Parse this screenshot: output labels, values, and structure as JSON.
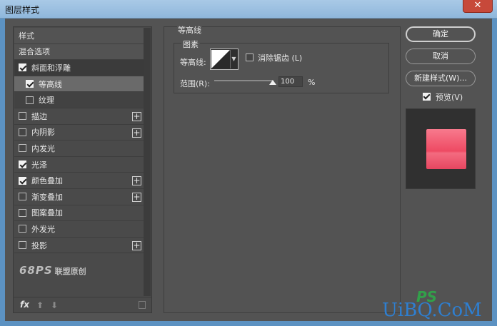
{
  "window": {
    "title": "图层样式",
    "close_glyph": "✕"
  },
  "styles_panel": {
    "items": [
      {
        "label": "样式",
        "type": "header"
      },
      {
        "label": "混合选项",
        "type": "header"
      },
      {
        "label": "斜面和浮雕",
        "checked": true
      },
      {
        "label": "等高线",
        "checked": true,
        "sub": true,
        "selected": true
      },
      {
        "label": "纹理",
        "checked": false,
        "sub": true
      },
      {
        "label": "描边",
        "checked": false,
        "plus": true
      },
      {
        "label": "内阴影",
        "checked": false,
        "plus": true
      },
      {
        "label": "内发光",
        "checked": false
      },
      {
        "label": "光泽",
        "checked": true
      },
      {
        "label": "颜色叠加",
        "checked": true,
        "plus": true
      },
      {
        "label": "渐变叠加",
        "checked": false,
        "plus": true
      },
      {
        "label": "图案叠加",
        "checked": false
      },
      {
        "label": "外发光",
        "checked": false
      },
      {
        "label": "投影",
        "checked": false,
        "plus": true
      }
    ],
    "plus_glyph": "+",
    "watermark": {
      "brand": "68PS",
      "text": "联盟原创"
    },
    "fx_label": "fx",
    "up_glyph": "⬆",
    "down_glyph": "⬇"
  },
  "contour": {
    "group_title": "等高线",
    "fieldset_title": "图素",
    "contour_label": "等高线:",
    "antialias_label": "消除锯齿 (L)",
    "antialias_checked": false,
    "range_label": "范围(R):",
    "range_value": "100",
    "range_unit": "%"
  },
  "buttons": {
    "ok": "确定",
    "cancel": "取消",
    "new_style": "新建样式(W)..."
  },
  "preview": {
    "label": "预览(V)",
    "checked": true
  },
  "site_watermark": {
    "text": "UiBQ.CoM",
    "ps": "PS"
  },
  "colors": {
    "panel_bg": "#535353",
    "swatch_pink": "#ee4a63",
    "title_blue": "#8fb7dc"
  }
}
